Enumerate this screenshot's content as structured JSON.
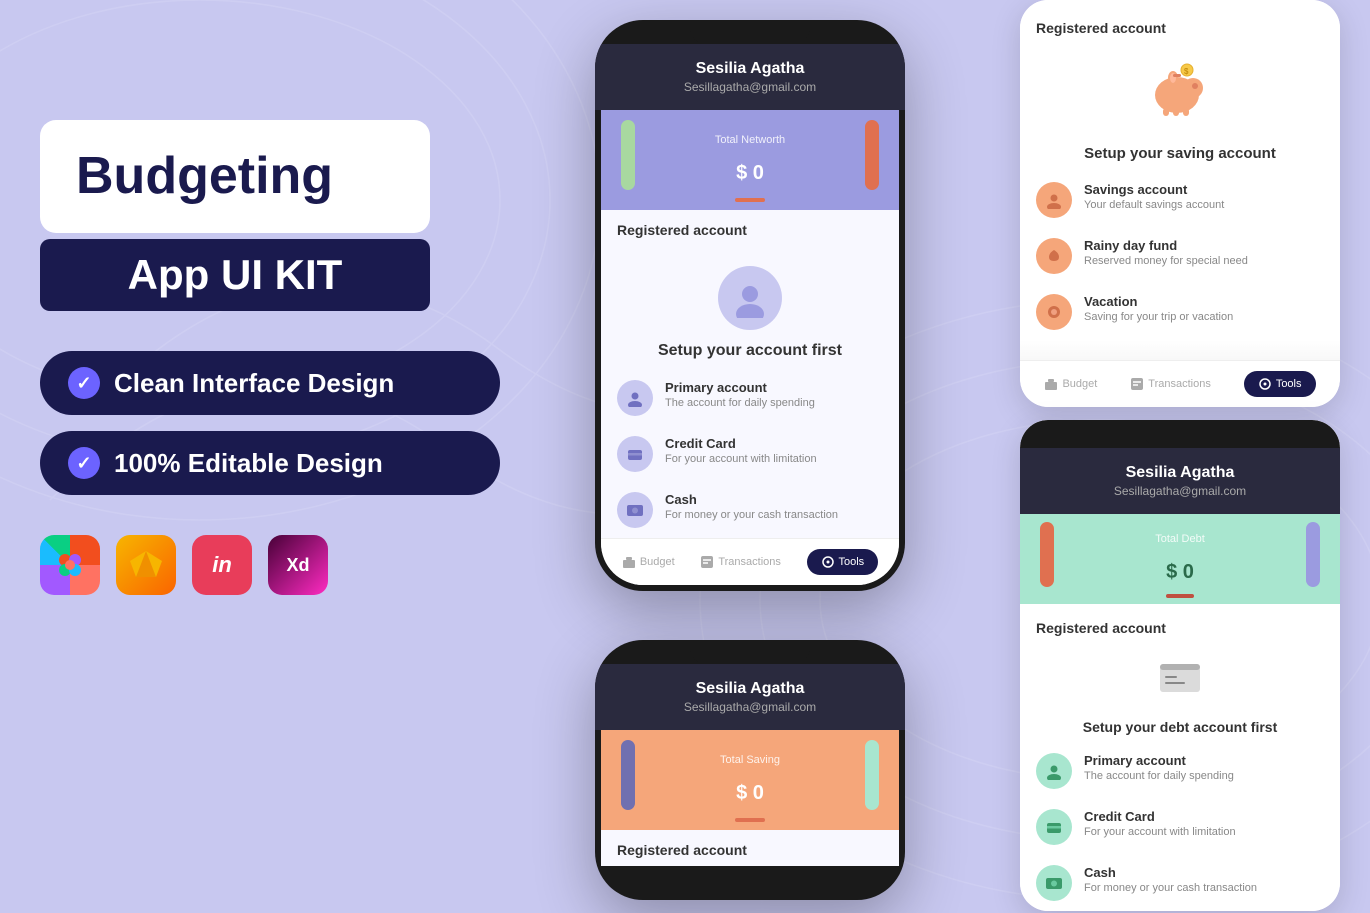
{
  "background": {
    "color": "#c8c8f0"
  },
  "left_panel": {
    "title_line1": "Budgeting",
    "title_line2": "App UI KIT",
    "features": [
      {
        "label": "Clean Interface Design"
      },
      {
        "label": "100% Editable Design"
      }
    ],
    "tools": [
      {
        "name": "figma",
        "label": "F"
      },
      {
        "name": "sketch",
        "label": "S"
      },
      {
        "name": "invision",
        "label": "in"
      },
      {
        "name": "xd",
        "label": "Xd"
      }
    ]
  },
  "phone_main": {
    "user_name": "Sesilia Agatha",
    "user_email": "Sesillagatha@gmail.com",
    "balance_label": "Total Networth",
    "balance_symbol": "$ ",
    "balance_amount": "0",
    "registered_section": "Registered account",
    "setup_title": "Setup your account first",
    "accounts": [
      {
        "name": "Primary account",
        "desc": "The account for daily spending"
      },
      {
        "name": "Credit Card",
        "desc": "For your account with limitation"
      },
      {
        "name": "Cash",
        "desc": "For money or your cash transaction"
      }
    ],
    "nav": [
      {
        "label": "Budget",
        "active": false
      },
      {
        "label": "Transactions",
        "active": false
      },
      {
        "label": "Tools",
        "active": true
      }
    ]
  },
  "phone_saving_bottom": {
    "user_name": "Sesilia Agatha",
    "user_email": "Sesillagatha@gmail.com",
    "balance_label": "Total Saving",
    "balance_symbol": "$ ",
    "balance_amount": "0",
    "registered_section": "Registered account"
  },
  "right_top": {
    "registered_section": "Registered account",
    "setup_title": "Setup your saving account",
    "accounts": [
      {
        "name": "Savings account",
        "desc": "Your default savings account"
      },
      {
        "name": "Rainy day fund",
        "desc": "Reserved money for special need"
      },
      {
        "name": "Vacation",
        "desc": "Saving for your trip or vacation"
      }
    ],
    "nav": [
      {
        "label": "Budget",
        "active": false
      },
      {
        "label": "Transactions",
        "active": false
      },
      {
        "label": "Tools",
        "active": true
      }
    ]
  },
  "right_bottom": {
    "user_name": "Sesilia Agatha",
    "user_email": "Sesillagatha@gmail.com",
    "balance_label": "Total Debt",
    "balance_symbol": "$ ",
    "balance_amount": "0",
    "registered_section": "Registered account",
    "setup_title": "Setup your debt account first",
    "accounts": [
      {
        "name": "Primary account",
        "desc": "The account for daily spending"
      },
      {
        "name": "Credit Card",
        "desc": "For your account with limitation"
      },
      {
        "name": "Cash",
        "desc": "For money or your cash transaction"
      }
    ]
  }
}
